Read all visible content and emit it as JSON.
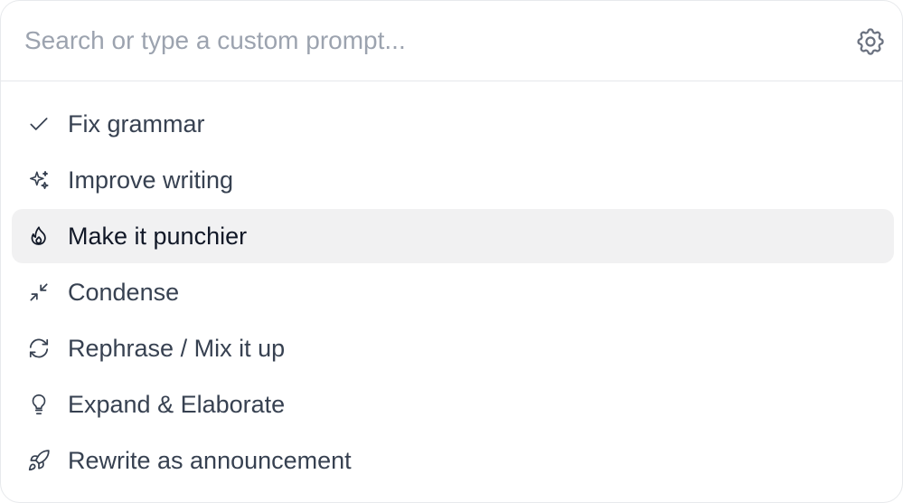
{
  "search": {
    "placeholder": "Search or type a custom prompt...",
    "value": ""
  },
  "settings": {
    "icon": "gear-icon"
  },
  "menu": {
    "active_index": 2,
    "items": [
      {
        "label": "Fix grammar",
        "icon": "check-icon"
      },
      {
        "label": "Improve writing",
        "icon": "sparkles-icon"
      },
      {
        "label": "Make it punchier",
        "icon": "flame-icon"
      },
      {
        "label": "Condense",
        "icon": "minimize-arrows-icon"
      },
      {
        "label": "Rephrase / Mix it up",
        "icon": "refresh-icon"
      },
      {
        "label": "Expand & Elaborate",
        "icon": "lightbulb-icon"
      },
      {
        "label": "Rewrite as announcement",
        "icon": "rocket-icon"
      }
    ]
  },
  "colors": {
    "text": "#374151",
    "placeholder": "#9ca3af",
    "active_bg": "#f1f1f2",
    "border": "#e5e7eb"
  }
}
